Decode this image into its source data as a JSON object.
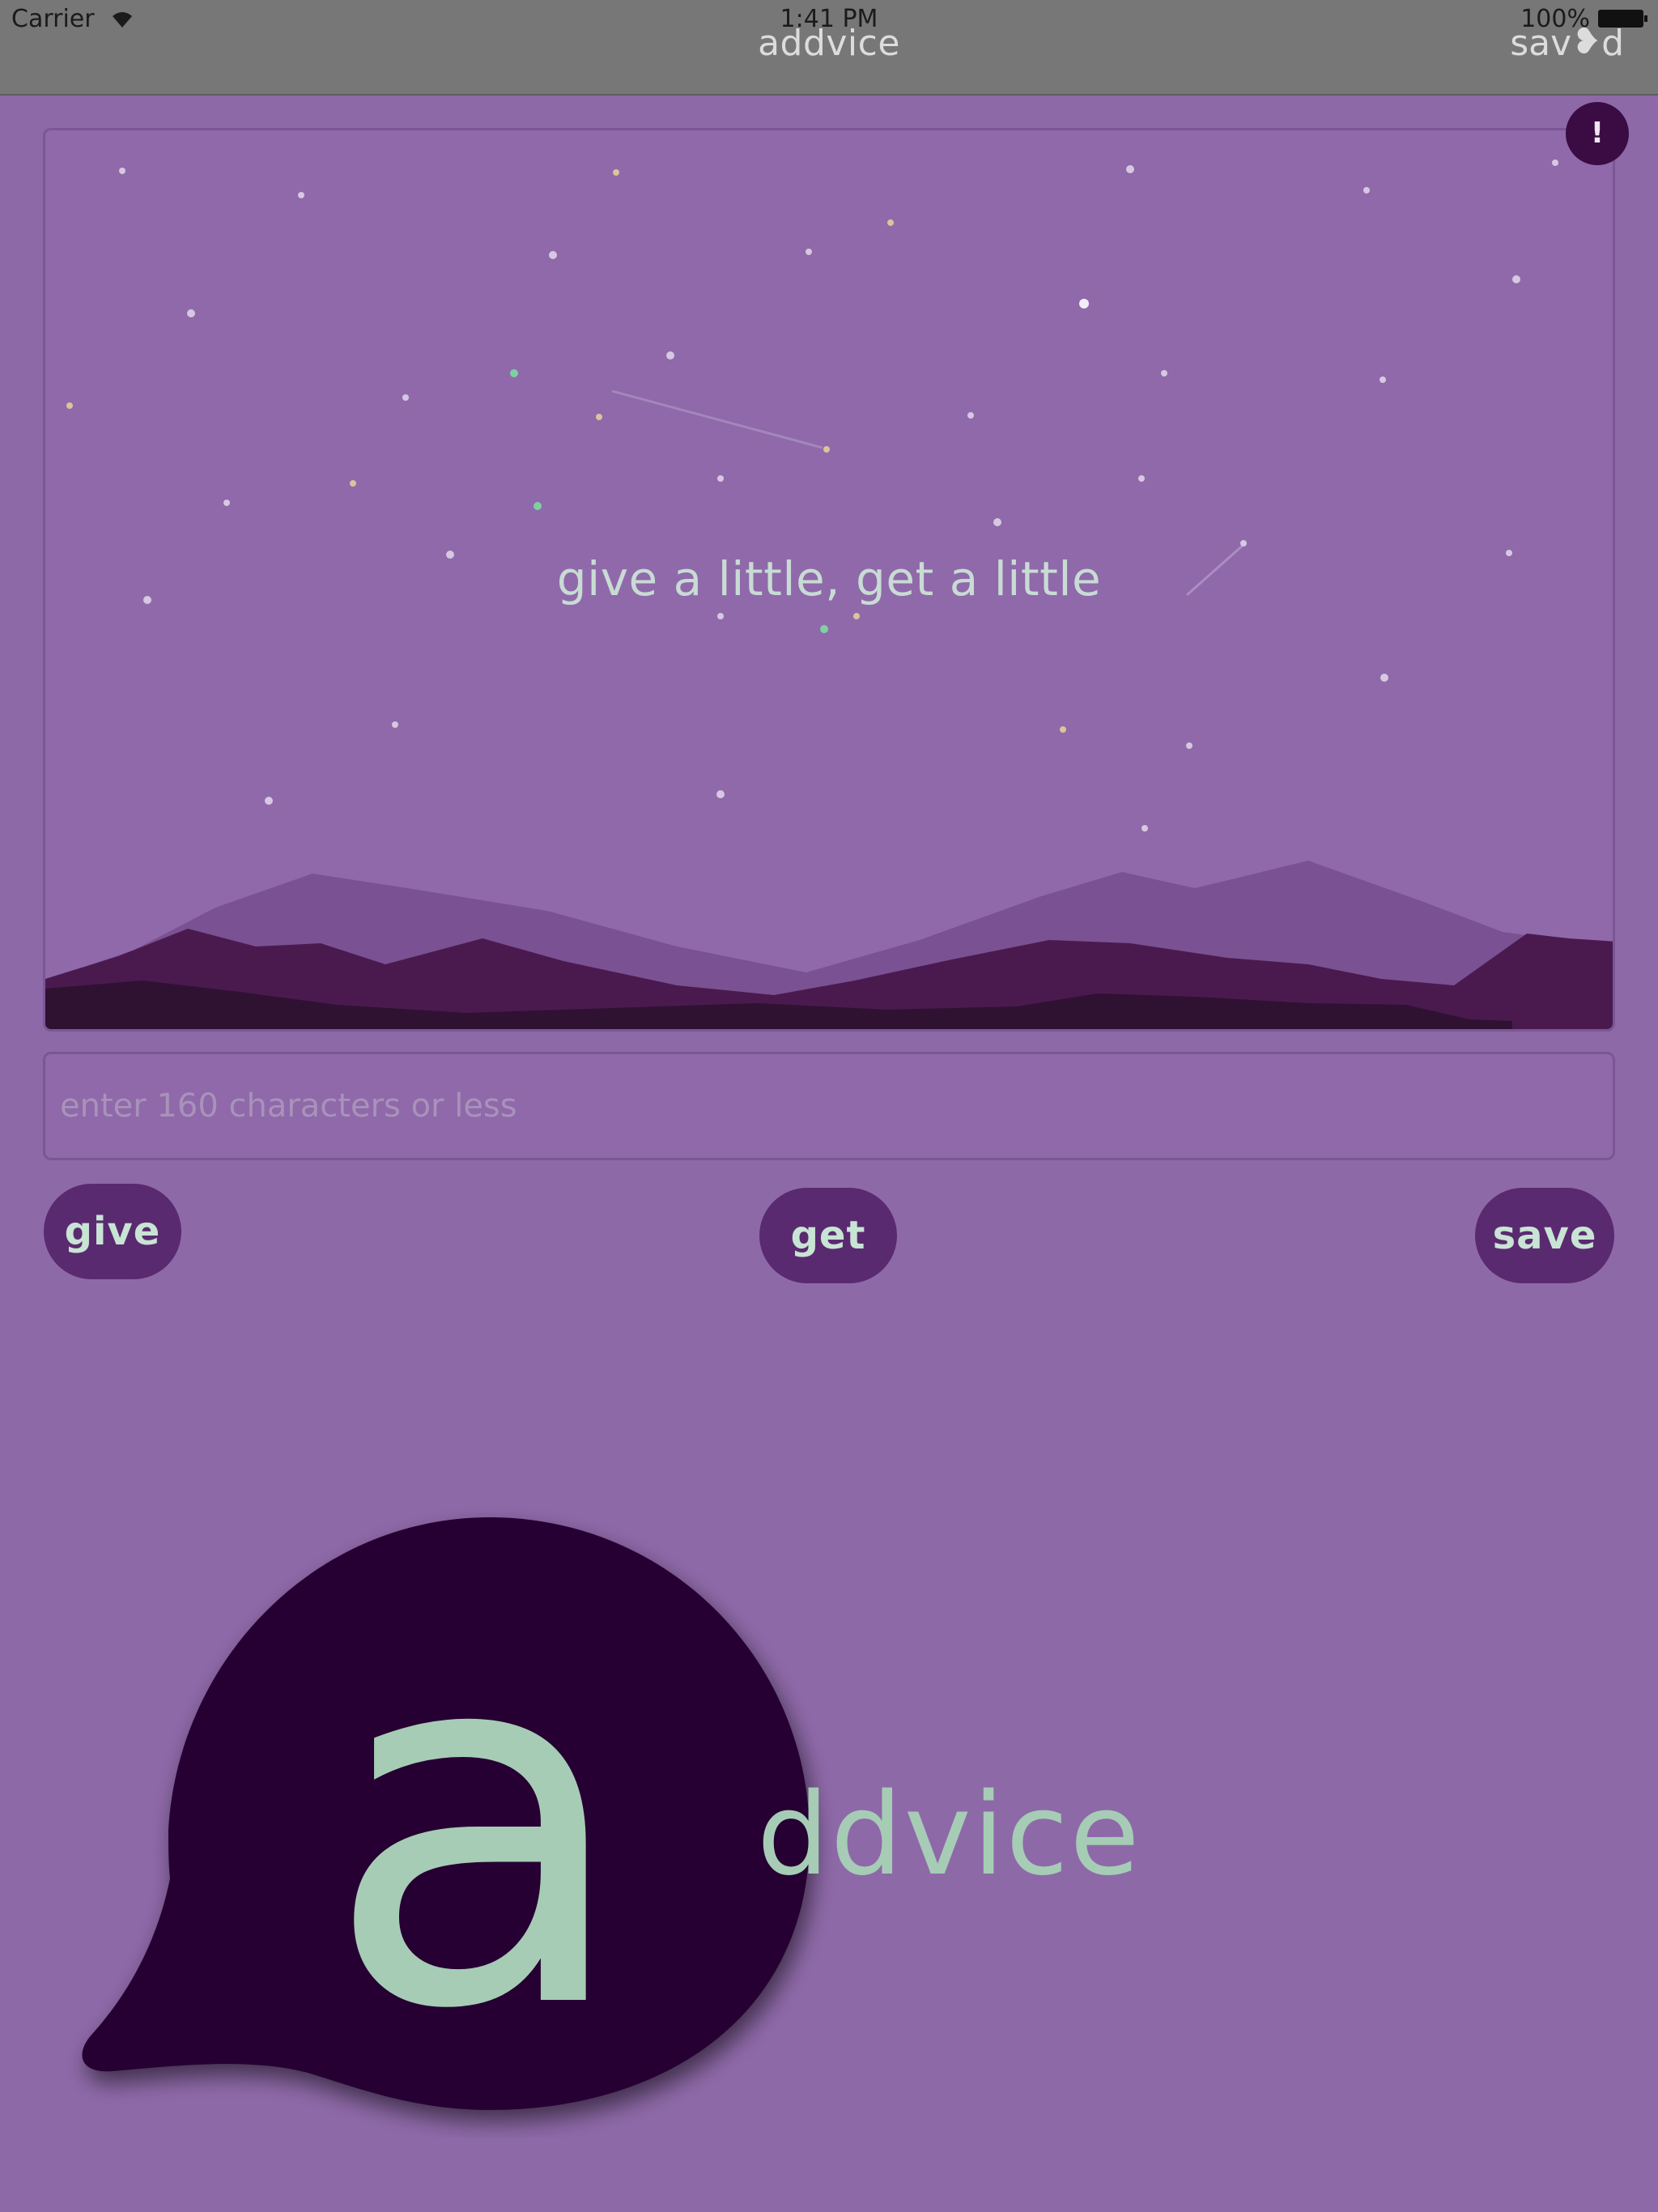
{
  "status_bar": {
    "carrier": "Carrier",
    "time": "1:41 PM",
    "battery": "100%"
  },
  "nav": {
    "title": "addvice",
    "saved_prefix": "sav",
    "saved_heart": "❥",
    "saved_suffix": "d"
  },
  "hero": {
    "tagline": "give a little, get a little",
    "alert_label": "!"
  },
  "input": {
    "placeholder": "enter 160 characters or less",
    "value": ""
  },
  "buttons": {
    "give": "give",
    "get": "get",
    "save": "save"
  },
  "logo": {
    "letter": "a",
    "word": "ddvice"
  },
  "colors": {
    "background": "#8e69a8",
    "nav_bar": "#777777",
    "button": "#5a2a70",
    "button_text": "#c8e4d4",
    "logo_bubble": "#250530",
    "logo_text": "#a6ccb6"
  }
}
